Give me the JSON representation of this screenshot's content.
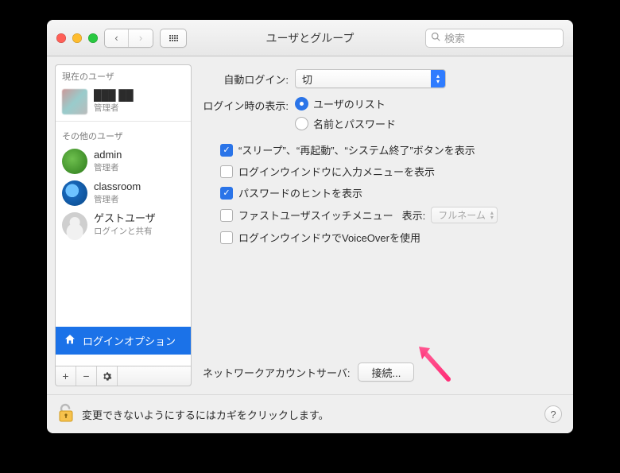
{
  "window": {
    "title": "ユーザとグループ",
    "search_placeholder": "検索"
  },
  "sidebar": {
    "section_current": "現在のユーザ",
    "section_other": "その他のユーザ",
    "users": [
      {
        "name": "███ ██",
        "role": "管理者"
      },
      {
        "name": "admin",
        "role": "管理者"
      },
      {
        "name": "classroom",
        "role": "管理者"
      },
      {
        "name": "ゲストユーザ",
        "role": "ログインと共有"
      }
    ],
    "login_options": "ログインオプション"
  },
  "main": {
    "auto_login_label": "自動ログイン:",
    "auto_login_value": "切",
    "login_display_label": "ログイン時の表示:",
    "radio_user_list": "ユーザのリスト",
    "radio_name_pass": "名前とパスワード",
    "cb_sleep_restart": "“スリープ”、“再起動”、“システム終了”ボタンを表示",
    "cb_input_menu": "ログインウインドウに入力メニューを表示",
    "cb_password_hint": "パスワードのヒントを表示",
    "cb_fast_user_label": "ファストユーザスイッチメニュー",
    "cb_fast_user_display": "表示:",
    "fast_user_value": "フルネーム",
    "cb_voiceover": "ログインウインドウでVoiceOverを使用",
    "network_server_label": "ネットワークアカウントサーバ:",
    "connect_button": "接続..."
  },
  "footer": {
    "lock_text": "変更できないようにするにはカギをクリックします。",
    "help": "?"
  },
  "glyphs": {
    "back": "‹",
    "forward": "›",
    "search": "🔍",
    "plus": "+",
    "minus": "−",
    "gear": "✿",
    "check": "✓",
    "tri_up": "▴",
    "tri_down": "▾"
  }
}
